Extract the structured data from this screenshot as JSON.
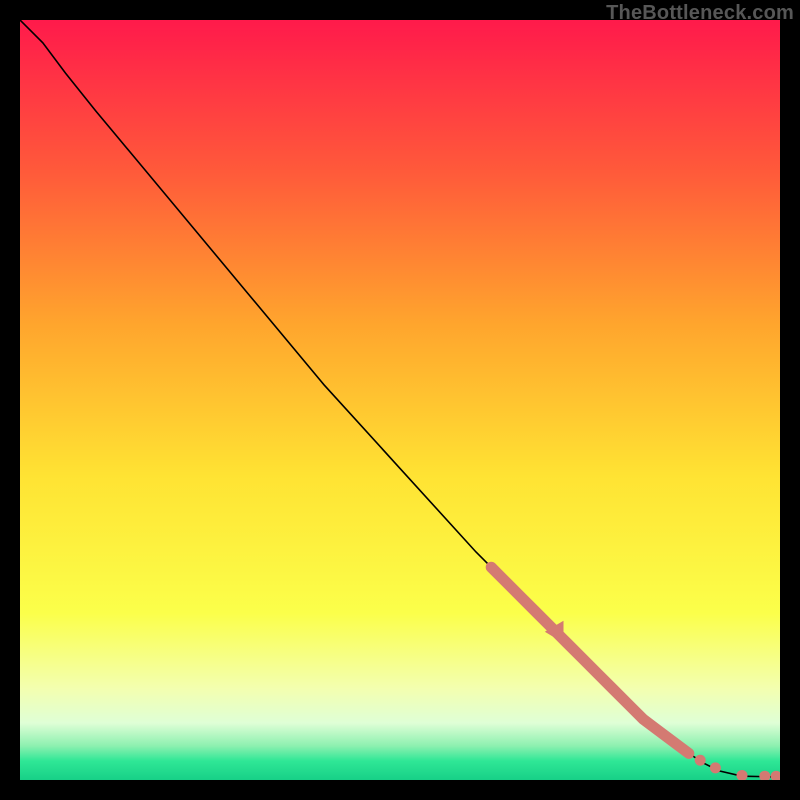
{
  "watermark": "TheBottleneck.com",
  "chart_data": {
    "type": "line",
    "title": "",
    "xlabel": "",
    "ylabel": "",
    "xlim": [
      0,
      100
    ],
    "ylim": [
      0,
      100
    ],
    "grid": false,
    "legend": false,
    "gradient_stops": [
      {
        "offset": 0.0,
        "color": "#ff1a4b"
      },
      {
        "offset": 0.2,
        "color": "#ff5a3a"
      },
      {
        "offset": 0.4,
        "color": "#ffa52d"
      },
      {
        "offset": 0.6,
        "color": "#ffe333"
      },
      {
        "offset": 0.78,
        "color": "#fbff4a"
      },
      {
        "offset": 0.88,
        "color": "#f3ffb0"
      },
      {
        "offset": 0.925,
        "color": "#dfffd6"
      },
      {
        "offset": 0.955,
        "color": "#8df0b0"
      },
      {
        "offset": 0.975,
        "color": "#2fe796"
      },
      {
        "offset": 1.0,
        "color": "#17d087"
      }
    ],
    "series": [
      {
        "name": "curve",
        "style": "line",
        "color": "#000000",
        "x": [
          0,
          3,
          6,
          10,
          15,
          20,
          30,
          40,
          50,
          60,
          65,
          70,
          75,
          80,
          85,
          88,
          90,
          92,
          95,
          100
        ],
        "y": [
          100,
          97,
          93,
          88,
          82,
          76,
          64,
          52,
          41,
          30,
          25,
          20,
          15,
          10,
          6,
          3.5,
          2.2,
          1.2,
          0.5,
          0.4
        ]
      },
      {
        "name": "highlight-segment",
        "style": "thick-line",
        "color": "#d47a72",
        "x": [
          62,
          64,
          66,
          68,
          70,
          72,
          74,
          76,
          78,
          80,
          82,
          84,
          86,
          88
        ],
        "y": [
          28,
          26,
          24,
          22,
          20,
          18,
          16,
          14,
          12,
          10,
          8,
          6.5,
          5,
          3.5
        ]
      },
      {
        "name": "arrow-marker",
        "style": "left-triangle",
        "color": "#d47a72",
        "x": [
          70.5
        ],
        "y": [
          19.5
        ]
      },
      {
        "name": "tail-dots",
        "style": "dots",
        "color": "#d47a72",
        "x": [
          89.5,
          91.5,
          95.0,
          98.0,
          99.5
        ],
        "y": [
          2.6,
          1.6,
          0.6,
          0.5,
          0.5
        ]
      }
    ]
  }
}
